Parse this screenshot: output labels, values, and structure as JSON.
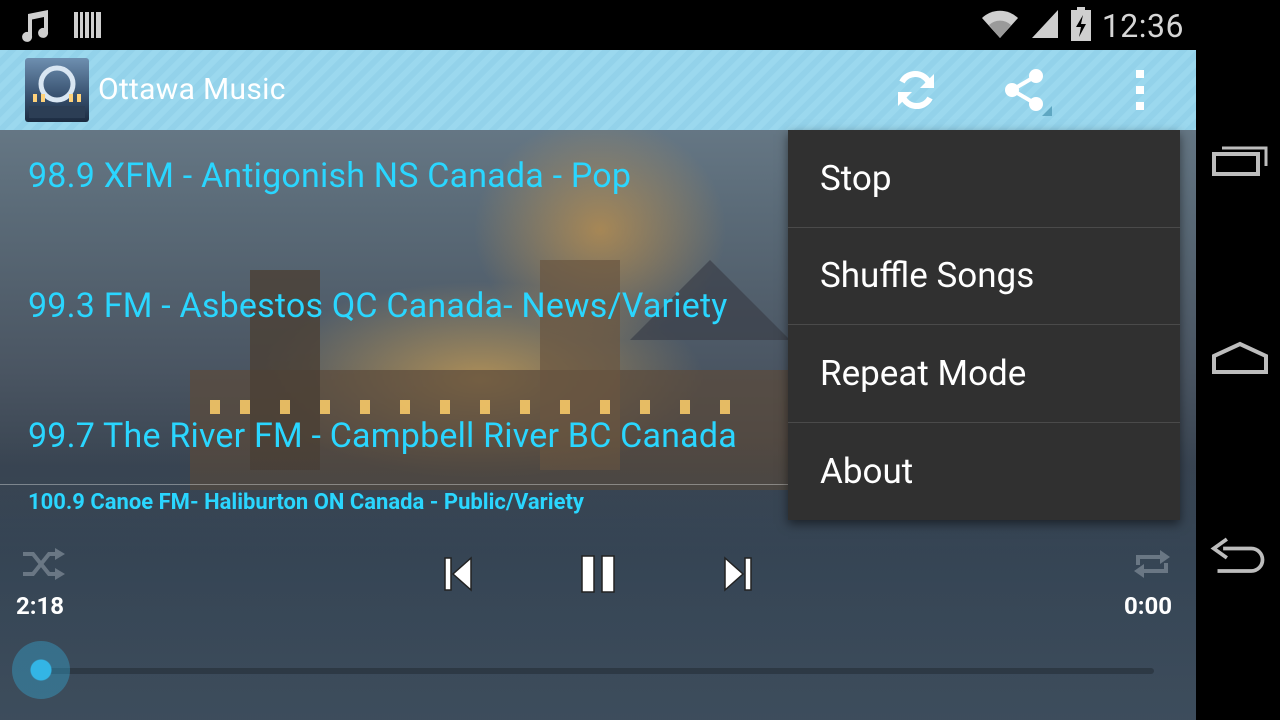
{
  "status_bar": {
    "time": "12:36",
    "left_icons": [
      "music-note-icon",
      "barcode-icon"
    ],
    "right_icons": [
      "wifi-icon",
      "signal-icon",
      "battery-charging-icon"
    ]
  },
  "action_bar": {
    "title": "Ottawa Music",
    "background_color": "#9bd8ee"
  },
  "stations": [
    {
      "label": "98.9 XFM - Antigonish NS Canada  - Pop"
    },
    {
      "label": "99.3 FM - Asbestos QC Canada- News/Variety"
    },
    {
      "label": "99.7 The River FM - Campbell River BC Canada"
    }
  ],
  "now_playing": "100.9 Canoe FM-  Haliburton ON Canada   -  Public/Variety",
  "player": {
    "elapsed": "2:18",
    "duration": "0:00",
    "progress": 0.0,
    "accent_color": "#33b5e5",
    "station_text_color": "#2ad6ff"
  },
  "menu": {
    "items": [
      "Stop",
      "Shuffle Songs",
      "Repeat Mode",
      "About"
    ]
  }
}
